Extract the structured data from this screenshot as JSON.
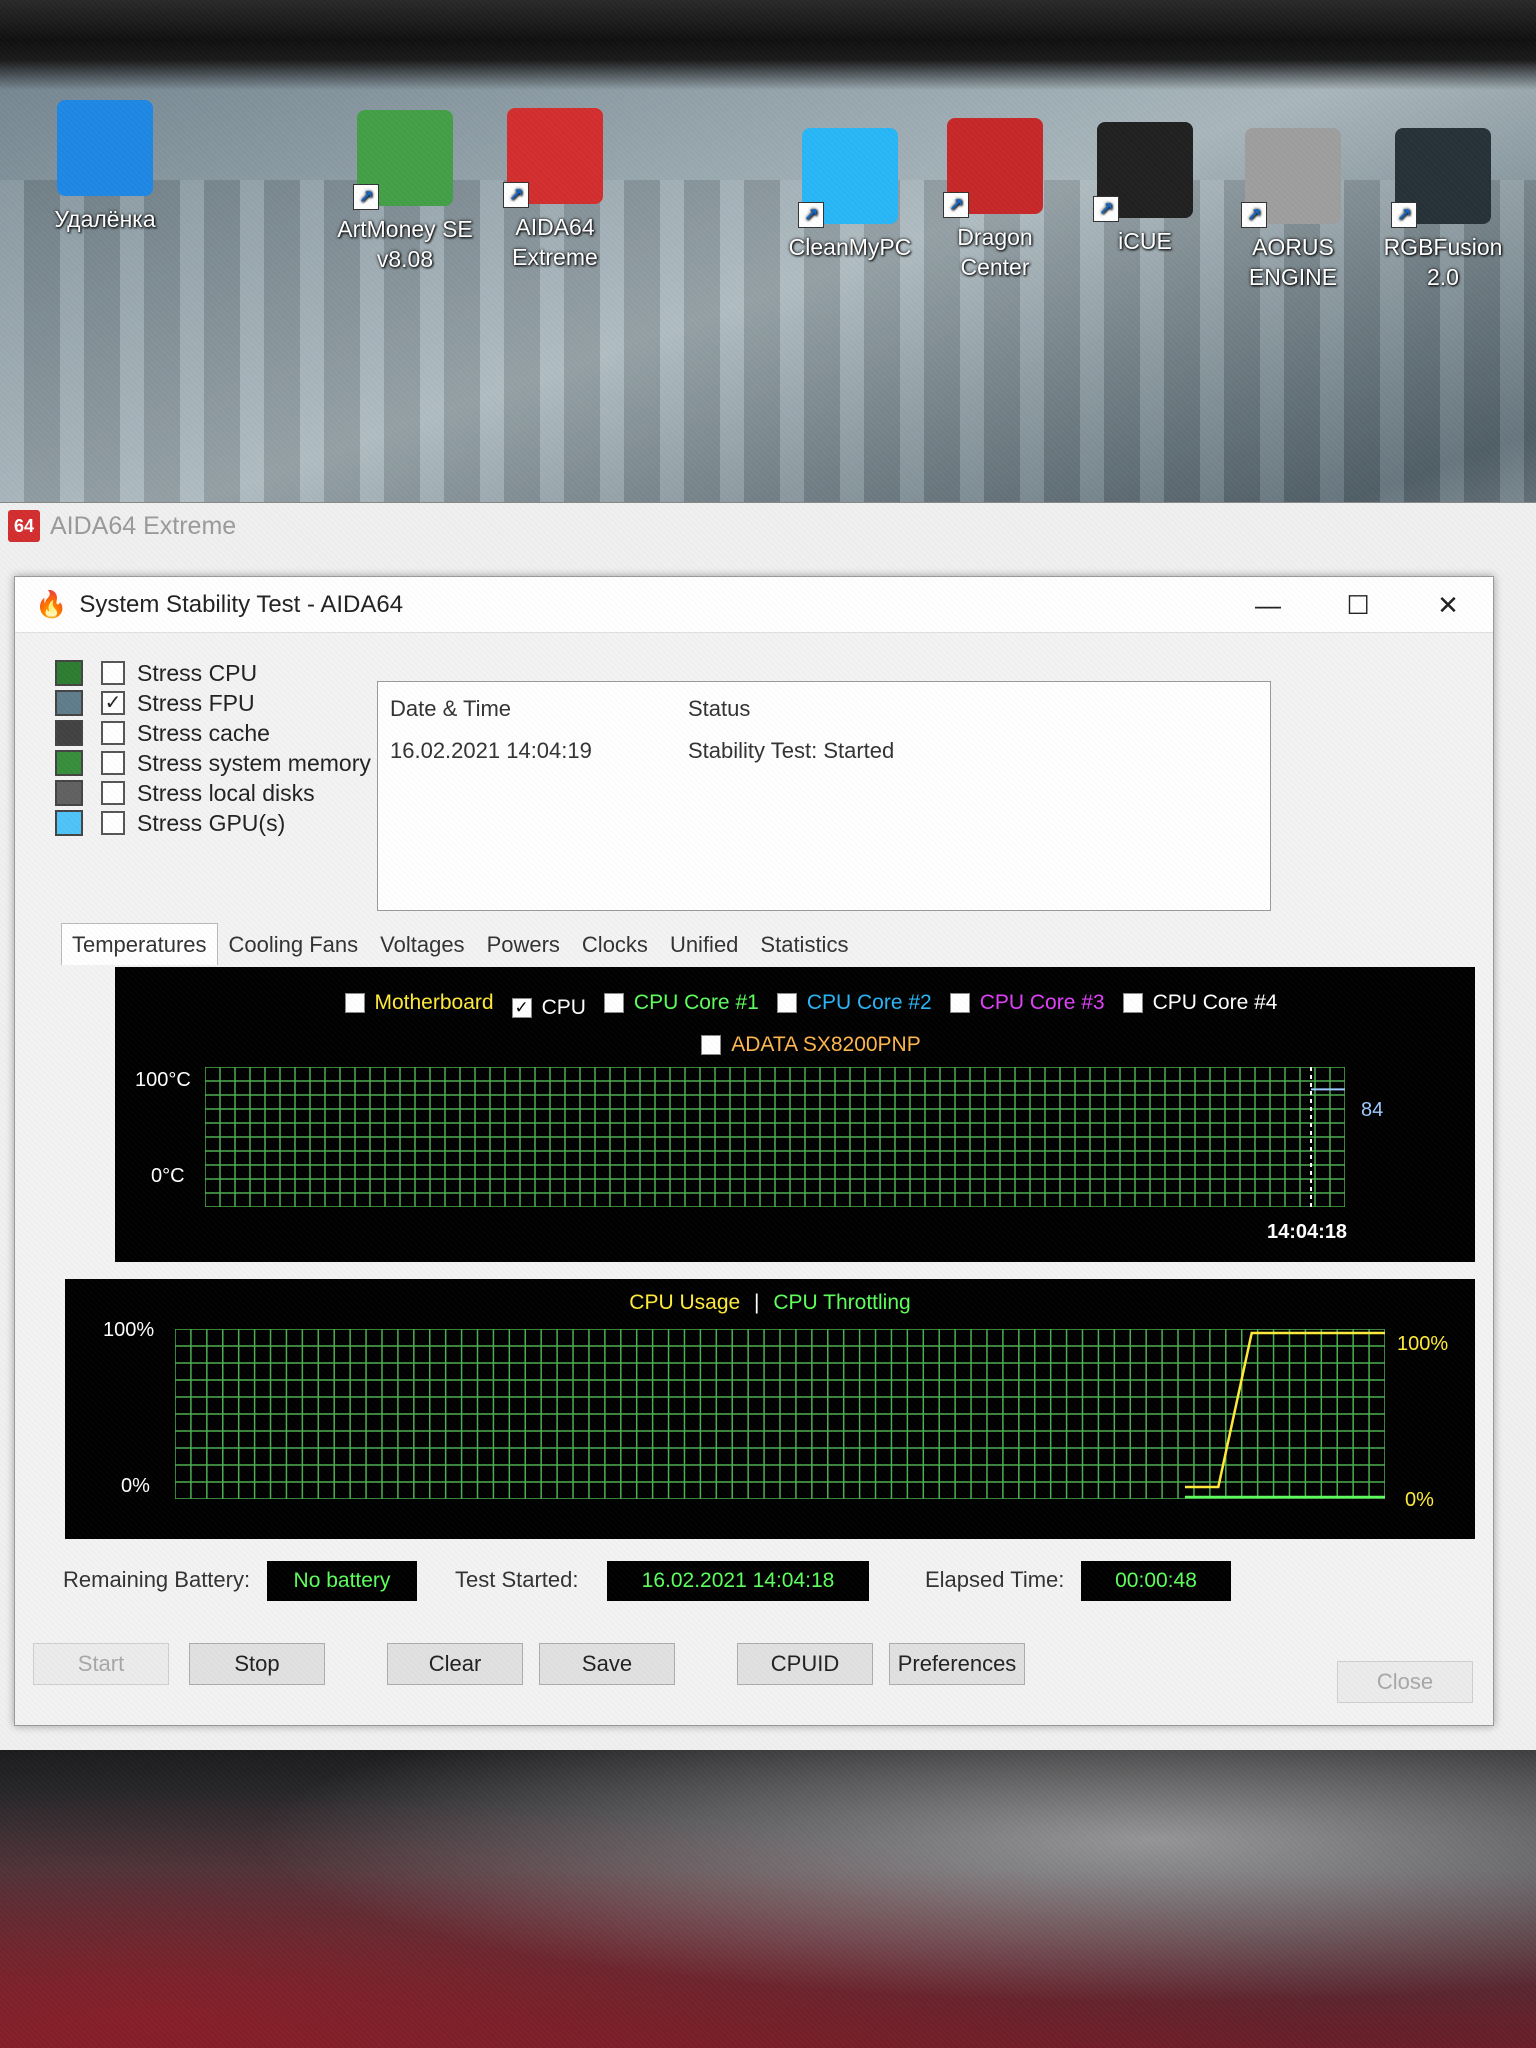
{
  "desktop": {
    "icons": [
      {
        "label": "Удалёнка",
        "icon": "remote-desktop-icon",
        "color": "#1e88e5"
      },
      {
        "label": "ArtMoney SE v8.08",
        "icon": "artmoney-icon",
        "color": "#43a047"
      },
      {
        "label": "AIDA64 Extreme",
        "icon": "aida64-icon",
        "color": "#d32f2f"
      },
      {
        "label": "CleanMyPC",
        "icon": "cleanmypc-icon",
        "color": "#29b6f6"
      },
      {
        "label": "Dragon Center",
        "icon": "dragon-center-icon",
        "color": "#c62828"
      },
      {
        "label": "iCUE",
        "icon": "icue-icon",
        "color": "#212121"
      },
      {
        "label": "AORUS ENGINE",
        "icon": "aorus-engine-icon",
        "color": "#9e9e9e"
      },
      {
        "label": "RGBFusion 2.0",
        "icon": "rgbfusion-icon",
        "color": "#263238"
      }
    ]
  },
  "parent_window": {
    "title": "AIDA64 Extreme",
    "logo": "64"
  },
  "dialog": {
    "title": "System Stability Test - AIDA64",
    "controls": {
      "minimize": "—",
      "maximize": "☐",
      "close": "✕"
    }
  },
  "stress_options": [
    {
      "label": "Stress CPU",
      "checked": false
    },
    {
      "label": "Stress FPU",
      "checked": true
    },
    {
      "label": "Stress cache",
      "checked": false
    },
    {
      "label": "Stress system memory",
      "checked": false
    },
    {
      "label": "Stress local disks",
      "checked": false
    },
    {
      "label": "Stress GPU(s)",
      "checked": false
    }
  ],
  "log": {
    "headers": [
      "Date & Time",
      "Status"
    ],
    "rows": [
      [
        "16.02.2021 14:04:19",
        "Stability Test: Started"
      ]
    ]
  },
  "tabs": [
    "Temperatures",
    "Cooling Fans",
    "Voltages",
    "Powers",
    "Clocks",
    "Unified",
    "Statistics"
  ],
  "active_tab": "Temperatures",
  "temp_chart": {
    "legend": [
      {
        "label": "Motherboard",
        "checked": false,
        "color": "#ffeb3b"
      },
      {
        "label": "CPU",
        "checked": true,
        "color": "#ffffff"
      },
      {
        "label": "CPU Core #1",
        "checked": false,
        "color": "#5cff5c"
      },
      {
        "label": "CPU Core #2",
        "checked": false,
        "color": "#29b6f6"
      },
      {
        "label": "CPU Core #3",
        "checked": false,
        "color": "#e040fb"
      },
      {
        "label": "CPU Core #4",
        "checked": false,
        "color": "#ffffff"
      },
      {
        "label": "ADATA SX8200PNP",
        "checked": false,
        "color": "#ffb74d"
      }
    ],
    "y_max_label": "100°C",
    "y_min_label": "0°C",
    "current_value_label": "84",
    "time_label": "14:04:18"
  },
  "usage_chart": {
    "title_usage": "CPU Usage",
    "separator": "|",
    "title_throttling": "CPU Throttling",
    "y_max_label": "100%",
    "y_min_label": "0%",
    "right_max_label": "100%",
    "right_min_label": "0%"
  },
  "chart_data": [
    {
      "type": "line",
      "title": "",
      "ylabel": "°C",
      "ylim": [
        0,
        100
      ],
      "series": [
        {
          "name": "CPU",
          "values": [
            84
          ]
        }
      ],
      "x": [
        "14:04:18"
      ]
    },
    {
      "type": "line",
      "title": "CPU Usage | CPU Throttling",
      "ylim": [
        0,
        100
      ],
      "series": [
        {
          "name": "CPU Usage",
          "values": [
            0,
            0,
            100,
            100,
            100,
            100,
            100
          ]
        },
        {
          "name": "CPU Throttling",
          "values": [
            0,
            0,
            0,
            0,
            0,
            0,
            0
          ]
        }
      ]
    }
  ],
  "status": {
    "battery_label": "Remaining Battery:",
    "battery_value": "No battery",
    "started_label": "Test Started:",
    "started_value": "16.02.2021 14:04:18",
    "elapsed_label": "Elapsed Time:",
    "elapsed_value": "00:00:48"
  },
  "buttons": {
    "start": "Start",
    "stop": "Stop",
    "clear": "Clear",
    "save": "Save",
    "cpuid": "CPUID",
    "preferences": "Preferences",
    "close": "Close"
  }
}
